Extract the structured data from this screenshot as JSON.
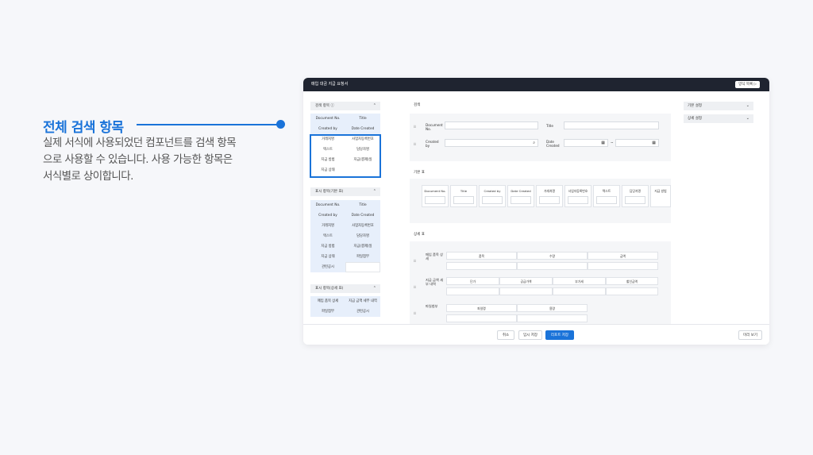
{
  "annotation": {
    "title": "전체 검색 항목",
    "desc_lines": [
      "실제 서식에 사용되었던 컴포넌트를 검색 항목",
      "으로 사용할 수 있습니다. 사용 가능한 항목은",
      "서식별로 상이합니다."
    ]
  },
  "window": {
    "title": "매입 대금 지급 요청서",
    "top_button": "양식 목록 ▷"
  },
  "left": {
    "search_items": {
      "header": "검색 항목 ⓘ",
      "cells": [
        "Document No.",
        "Title",
        "Created by",
        "Date Created",
        "거래처명",
        "사업자등록번호",
        "텍스트",
        "담당자명",
        "지급 방법",
        "지급(결제)일",
        "지급 상태",
        ""
      ]
    },
    "display_basic": {
      "header": "표시 항목(기본 표)",
      "cells": [
        "Document No.",
        "Title",
        "Created by",
        "Date Created",
        "거래처명",
        "사업자등록번호",
        "텍스트",
        "담당자명",
        "지급 방법",
        "지급(결제)일",
        "지급 상태",
        "파일첨부",
        "관련공시",
        ""
      ]
    },
    "display_detail": {
      "header": "표시 항목(상세 표)",
      "cells": [
        "매입 품목 상세",
        "지급 금액 세부 내역",
        "파일첨부",
        "관련공시"
      ]
    }
  },
  "center": {
    "search_label": "검색",
    "row_mark": "⠿",
    "docno_label": "Document No.",
    "title_label": "Title",
    "created_by_label": "Created by",
    "date_created_label": "Date Created",
    "date_sep": "~",
    "basic_table_label": "기본 표",
    "basic_cols": [
      "Document No.",
      "Title",
      "Created by",
      "Date Created",
      "거래처명",
      "사업자등록번호",
      "텍스트",
      "담당자명",
      "지급 방법"
    ],
    "detail_table_label": "상세 표",
    "detail_rows": [
      {
        "label": "매입 품목 상세",
        "cols": [
          "품목",
          "수량",
          "금액"
        ]
      },
      {
        "label": "지급 금액 세부 내역",
        "cols": [
          "단가",
          "공급가액",
          "부가세",
          "할인금액"
        ]
      },
      {
        "label": "파일첨부",
        "cols": [
          "파일명",
          "용량"
        ]
      }
    ]
  },
  "right": {
    "basic_settings": "기본 설정",
    "detail_settings": "상세 설정"
  },
  "bottom": {
    "cancel": "취소",
    "temp_save": "임시 저장",
    "report_save": "리포트 저장",
    "preview": "미리 보기"
  }
}
